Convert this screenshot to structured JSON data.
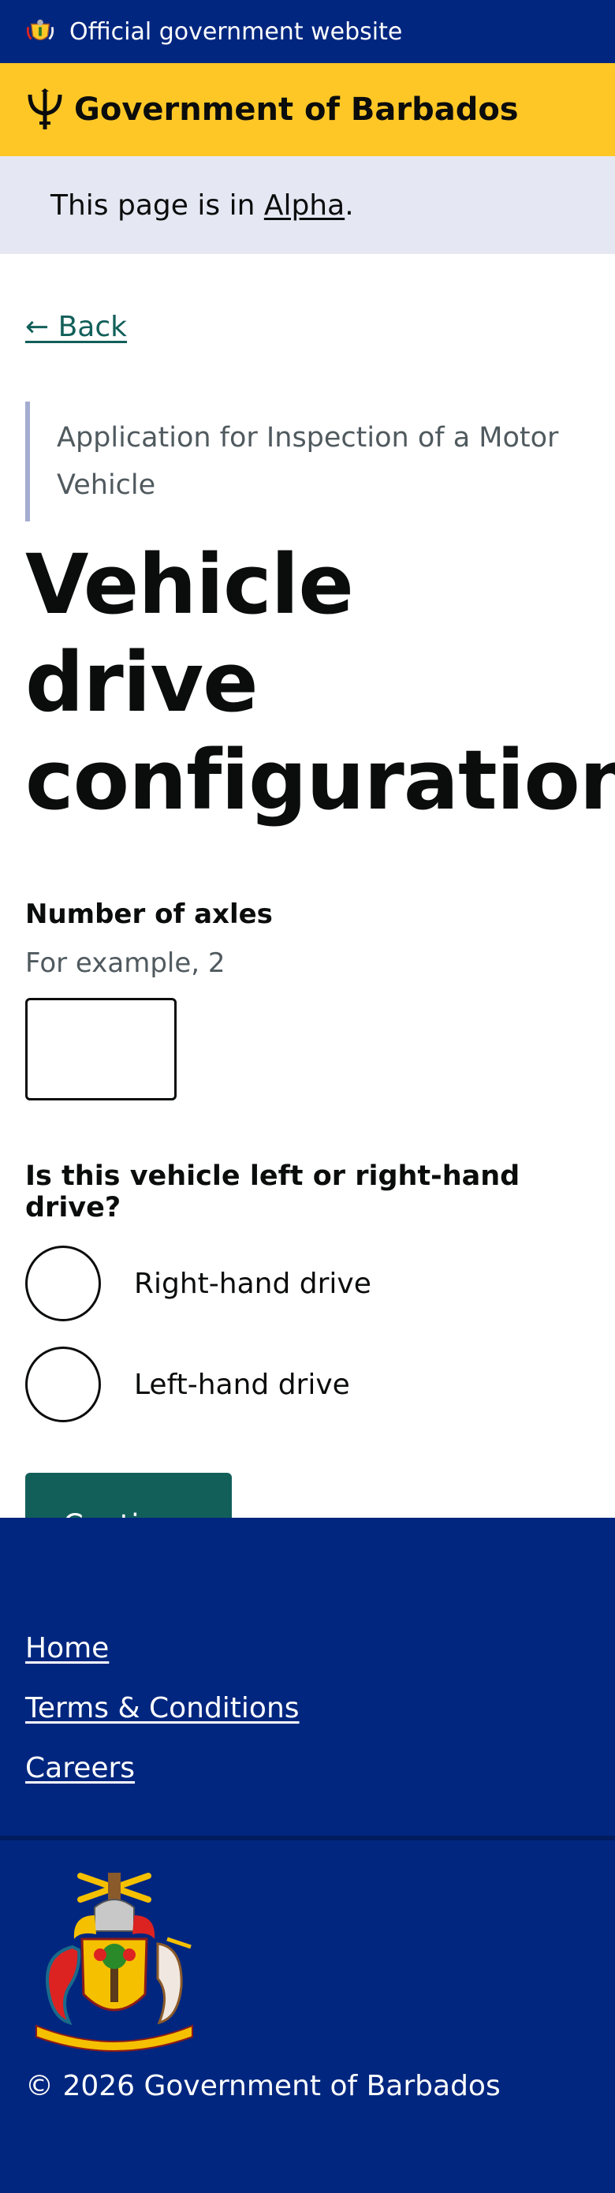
{
  "header": {
    "official_text": "Official government website",
    "brand_name": "Government of Barbados"
  },
  "phase": {
    "prefix": "This page is in ",
    "link_text": "Alpha",
    "suffix": "."
  },
  "back_link": "← Back",
  "caption": "Application for Inspection of a Motor Vehicle",
  "title": "Vehicle drive configuration",
  "axles": {
    "label": "Number of axles",
    "hint": "For example, 2",
    "value": ""
  },
  "drive": {
    "legend": "Is this vehicle left or right-hand drive?",
    "options": [
      "Right-hand drive",
      "Left-hand drive"
    ]
  },
  "continue_label": "Continue",
  "footer": {
    "links": [
      "Home",
      "Terms & Conditions",
      "Careers"
    ],
    "copyright": "© 2026 Government of Barbados"
  },
  "colors": {
    "navy": "#00267f",
    "yellow": "#ffc726",
    "teal": "#125f5a",
    "phase_bg": "#e5e8f2"
  }
}
